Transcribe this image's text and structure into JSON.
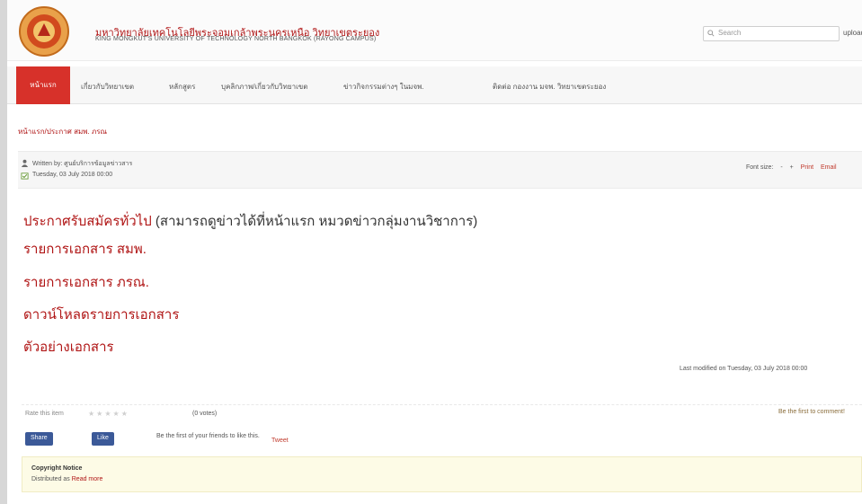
{
  "header": {
    "title": "มหาวิทยาลัยเทคโนโลยีพระจอมเกล้าพระนครเหนือ วิทยาเขตระยอง",
    "subtitle": "KING MONGKUT'S UNIVERSITY OF TECHNOLOGY NORTH BANGKOK (RAYONG CAMPUS)",
    "search_placeholder": "Search",
    "right_link": "upload"
  },
  "nav": {
    "home": "หน้าแรก",
    "items": [
      "เกี่ยวกับวิทยาเขต",
      "หลักสูตร",
      "บุคลิกภาพ/เกี่ยวกับวิทยาเขต",
      "ข่าวกิจกรรมต่างๆ ในมจพ.",
      "ติดต่อ กองงาน มจพ. วิทยาเขตระยอง"
    ]
  },
  "breadcrumb": "หน้าแรก/ประกาศ สมพ. ภรณ",
  "article_info": {
    "written_by": "Written by: ศูนย์บริการข้อมูลข่าวสาร",
    "date": "Tuesday, 03 July 2018 00:00",
    "tools": [
      "Font size:",
      "-",
      "+",
      "Print",
      "Email"
    ]
  },
  "content": {
    "announce": "ประกาศรับสมัครทั่วไป",
    "announce_note": "(สามารถดูข่าวได้ที่หน้าแรก หมวดข่าวกลุ่มงานวิชาการ)",
    "links": [
      "รายการเอกสาร สมพ.",
      "รายการเอกสาร ภรณ.",
      "ดาวน์โหลดรายการเอกสาร",
      "ตัวอย่างเอกสาร"
    ]
  },
  "last_modified": "Last modified on Tuesday, 03 July 2018 00:00",
  "rating": {
    "label": "Rate this item",
    "votes": "(0 votes)",
    "right_link": "Be the first to comment!"
  },
  "social": {
    "share": "Share",
    "like": "Like",
    "like_text": "Be the first of your friends to like this.",
    "plus": "Tweet"
  },
  "copyright": {
    "title": "Copyright Notice",
    "text": "Distributed as",
    "link": "Read more"
  },
  "colors": {
    "brand_red": "#b01515",
    "nav_active": "#d7312a",
    "facebook": "#3b5998"
  }
}
